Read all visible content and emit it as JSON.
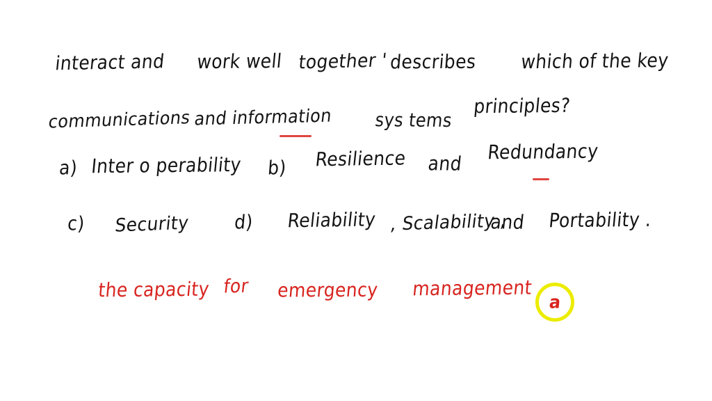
{
  "page": {
    "background_color": "#ffffff",
    "ink_black": "#141414",
    "ink_red": "#d8241f",
    "highlight_yellow": "#ecec00",
    "underline_red": "#e0453f",
    "medium": "handwritten-note"
  },
  "question": {
    "line1": {
      "seg1": "interact and",
      "seg2": "work well",
      "seg3": "together '",
      "seg4": "describes",
      "seg5": "which of the key"
    },
    "line2": {
      "seg1": "communications",
      "seg2": "and information",
      "seg3": "sys tems",
      "seg4": "principles?"
    },
    "full_text": "interact and work well together ' describes which of the key communications and information systems principles?"
  },
  "options": [
    {
      "letter": "a)",
      "text": "Inter o perability"
    },
    {
      "letter": "b)",
      "text": "Resilience",
      "extra1": "and",
      "extra2": "Redundancy"
    },
    {
      "letter": "c)",
      "text": "Security"
    },
    {
      "letter": "d)",
      "text": "Reliability",
      "extra1": ", Scalability ,",
      "extra2": "and",
      "extra3": "Portability ."
    }
  ],
  "answer": {
    "seg1": "the capacity",
    "seg2": "for",
    "seg3": "emergency",
    "seg4": "management",
    "circled_letter": "a",
    "full_text": "the capacity for emergency management"
  },
  "annotations": {
    "underline_information": "red underline beneath 'rmat' of information",
    "underline_redundancy": "short red dash beneath 'edu' of Redundancy",
    "circle_answer": "yellow circle around the letter a"
  }
}
